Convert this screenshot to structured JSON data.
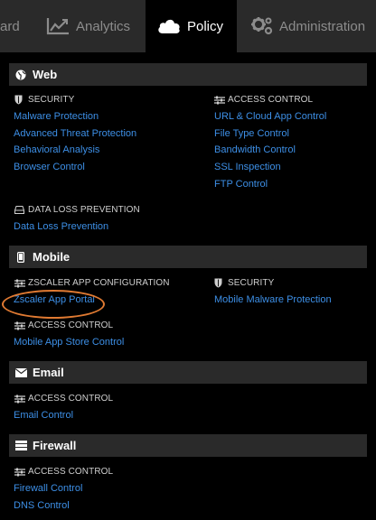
{
  "tabs": {
    "dashboard": "ard",
    "analytics": "Analytics",
    "policy": "Policy",
    "administration": "Administration"
  },
  "web": {
    "title": "Web",
    "security_header": "SECURITY",
    "security_links": [
      "Malware Protection",
      "Advanced Threat Protection",
      "Behavioral Analysis",
      "Browser Control"
    ],
    "access_header": "ACCESS CONTROL",
    "access_links": [
      "URL & Cloud App Control",
      "File Type Control",
      "Bandwidth Control",
      "SSL Inspection",
      "FTP Control"
    ],
    "dlp_header": "DATA LOSS PREVENTION",
    "dlp_links": [
      "Data Loss Prevention"
    ]
  },
  "mobile": {
    "title": "Mobile",
    "config_header": "ZSCALER APP CONFIGURATION",
    "config_links": [
      "Zscaler App Portal"
    ],
    "security_header": "SECURITY",
    "security_links": [
      "Mobile Malware Protection"
    ],
    "access_header": "ACCESS CONTROL",
    "access_links": [
      "Mobile App Store Control"
    ]
  },
  "email": {
    "title": "Email",
    "access_header": "ACCESS CONTROL",
    "access_links": [
      "Email Control"
    ]
  },
  "firewall": {
    "title": "Firewall",
    "access_header": "ACCESS CONTROL",
    "access_links": [
      "Firewall Control",
      "DNS Control"
    ]
  },
  "colors": {
    "link": "#3d8fe6",
    "highlight_circle": "#e07a32",
    "section_bg": "#2a2a2a"
  },
  "icons": [
    "chart-icon",
    "cloud-icon",
    "gears-icon",
    "globe-icon",
    "shield-icon",
    "sliders-icon",
    "drive-icon",
    "phone-icon",
    "envelope-icon",
    "firewall-icon"
  ]
}
